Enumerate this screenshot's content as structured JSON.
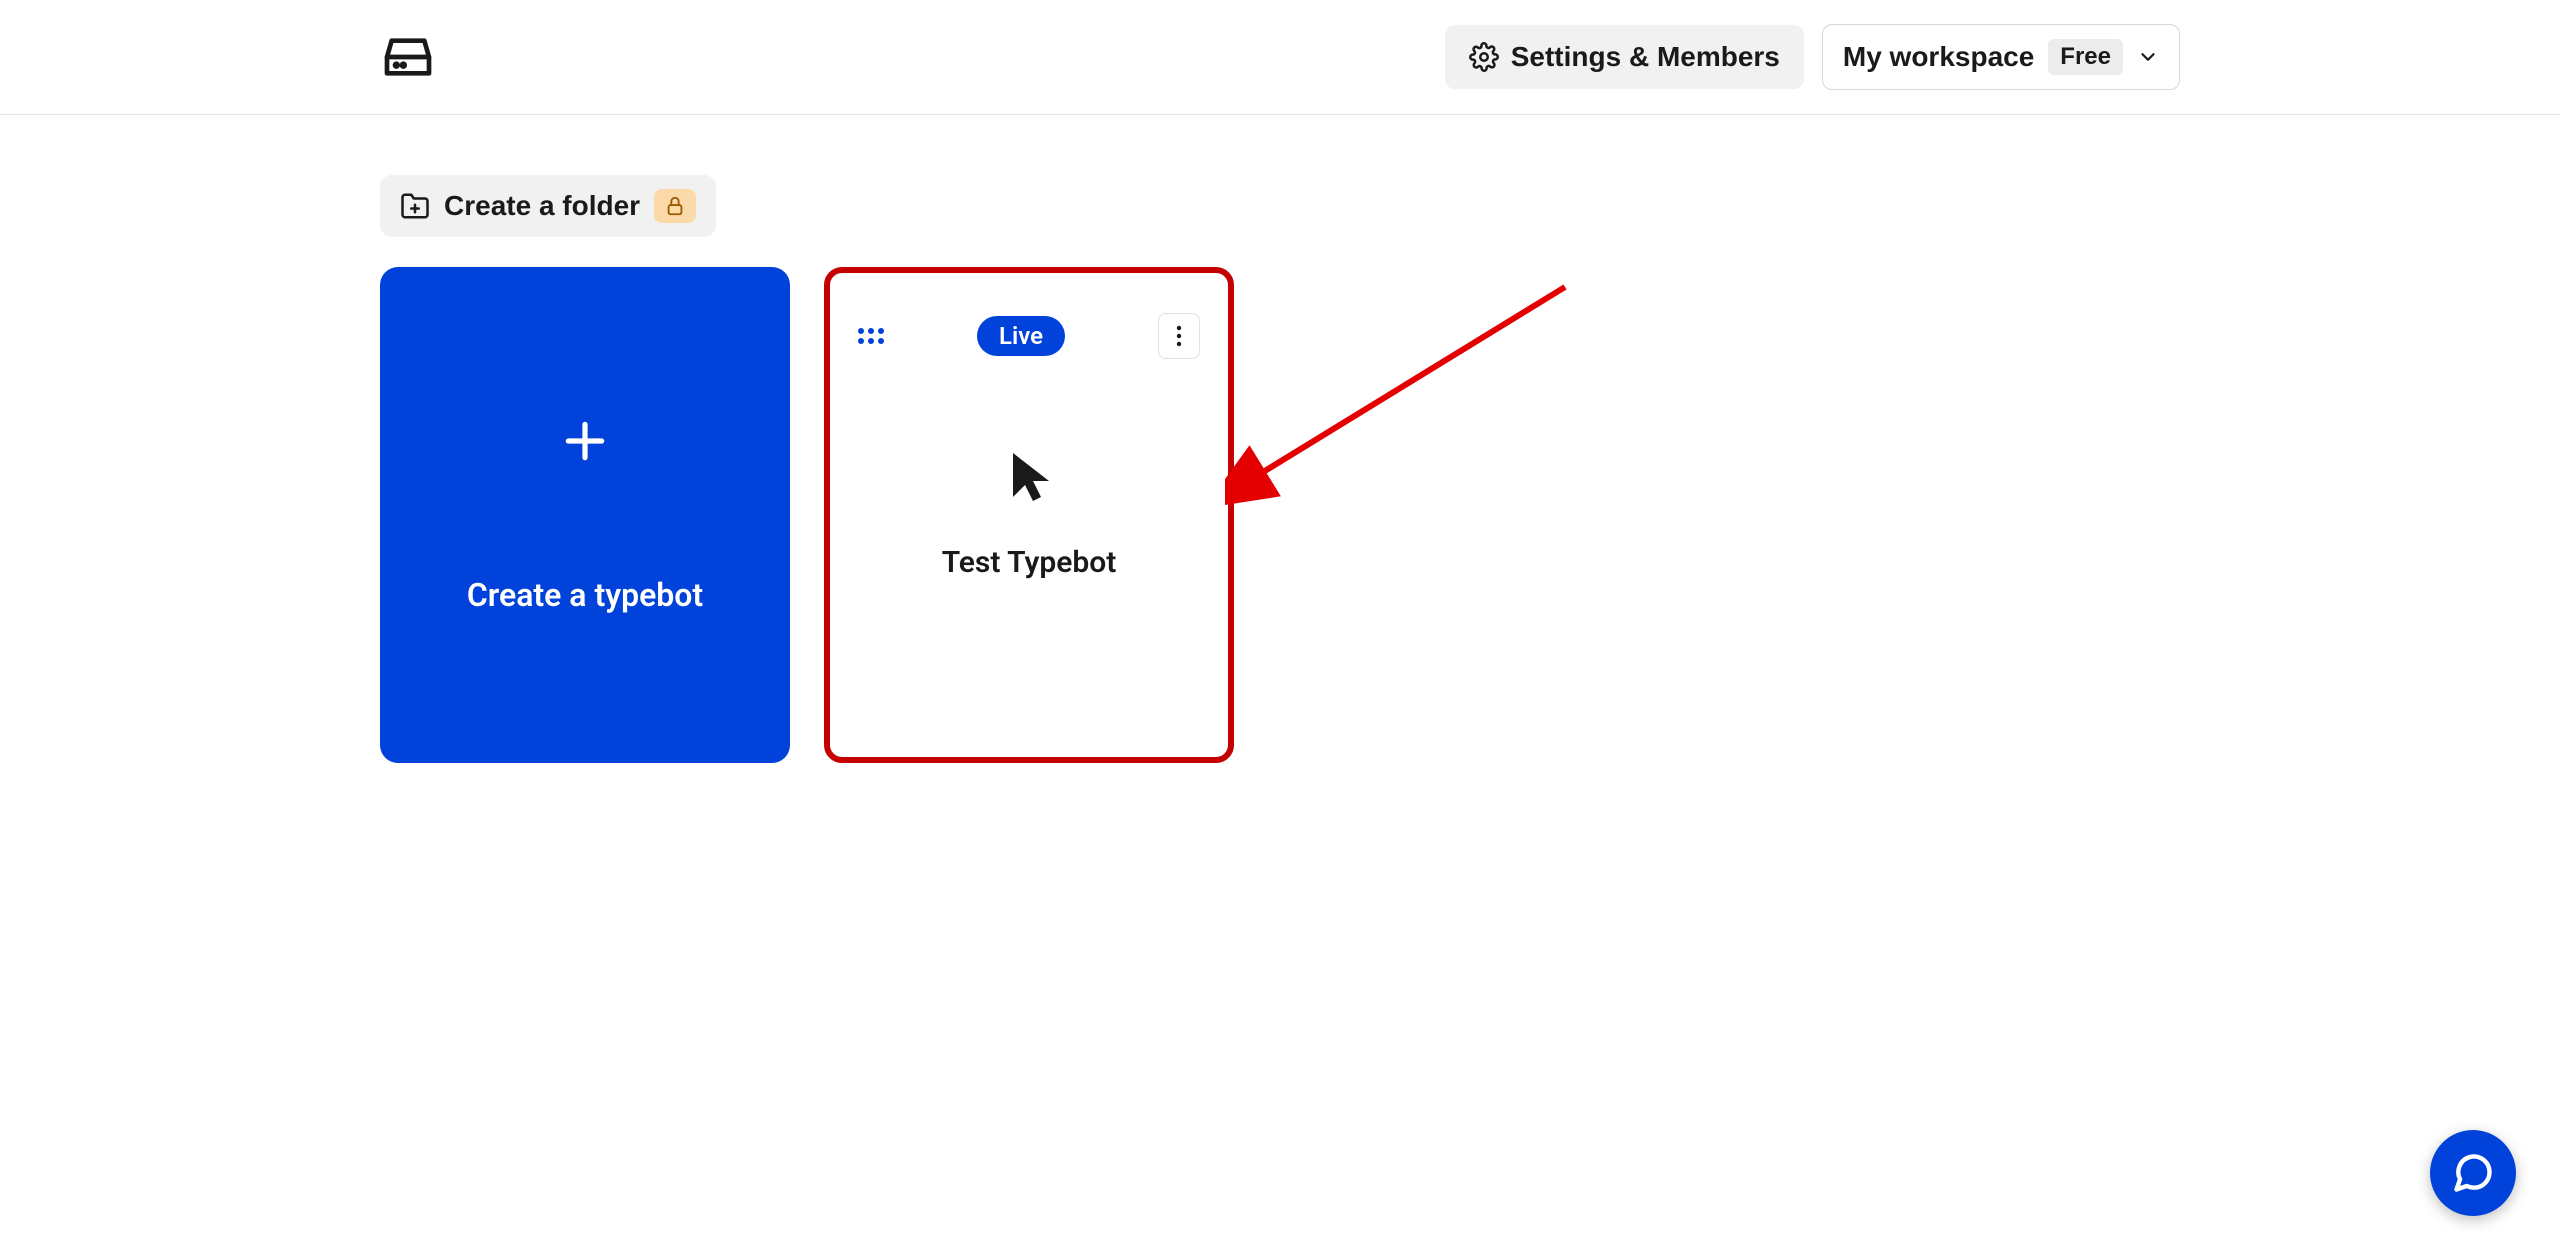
{
  "header": {
    "settings_label": "Settings & Members",
    "workspace_label": "My workspace",
    "plan_badge": "Free"
  },
  "toolbar": {
    "create_folder_label": "Create a folder"
  },
  "cards": {
    "create_typebot_label": "Create a typebot",
    "bot": {
      "status": "Live",
      "name": "Test Typebot"
    }
  }
}
